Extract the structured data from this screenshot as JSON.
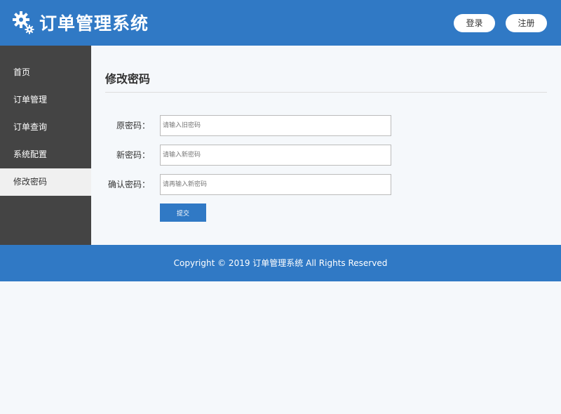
{
  "header": {
    "logo_icon": "gears-icon",
    "title": "订单管理系统",
    "login_label": "登录",
    "register_label": "注册"
  },
  "sidebar": {
    "items": [
      {
        "label": "首页"
      },
      {
        "label": "订单管理"
      },
      {
        "label": "订单查询"
      },
      {
        "label": "系统配置"
      },
      {
        "label": "修改密码",
        "active": true
      }
    ]
  },
  "main": {
    "title": "修改密码",
    "form": {
      "old_password": {
        "label": "原密码：",
        "placeholder": "请输入旧密码",
        "value": ""
      },
      "new_password": {
        "label": "新密码：",
        "placeholder": "请输入新密码",
        "value": ""
      },
      "confirm_password": {
        "label": "确认密码：",
        "placeholder": "请再输入新密码",
        "value": ""
      },
      "submit_label": "提交"
    }
  },
  "footer": {
    "copyright": "Copyright © 2019 订单管理系统 All Rights Reserved"
  },
  "colors": {
    "primary": "#3079c5",
    "sidebar_bg": "#444444",
    "active_item_bg": "#f0f0f0",
    "page_bg": "#f5f8fb"
  }
}
